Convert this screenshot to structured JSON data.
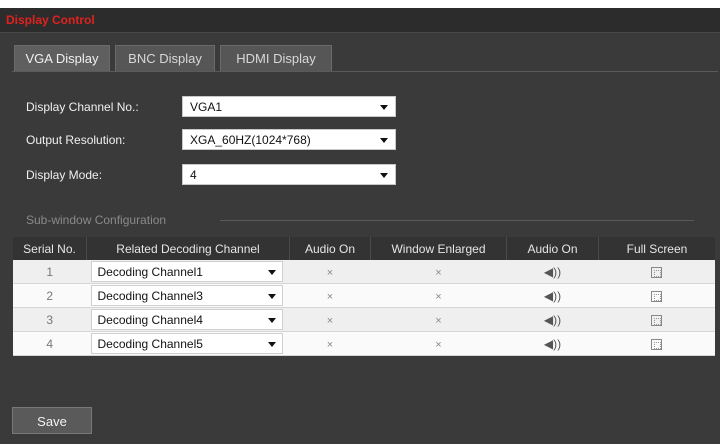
{
  "window": {
    "title": "Display Control"
  },
  "tabs": [
    {
      "label": "VGA Display",
      "active": true
    },
    {
      "label": "BNC Display",
      "active": false
    },
    {
      "label": "HDMI Display",
      "active": false
    }
  ],
  "form": {
    "display_channel": {
      "label": "Display Channel No.:",
      "value": "VGA1"
    },
    "output_resolution": {
      "label": "Output Resolution:",
      "value": "XGA_60HZ(1024*768)"
    },
    "display_mode": {
      "label": "Display Mode:",
      "value": "4"
    }
  },
  "subwindow": {
    "section_title": "Sub-window Configuration",
    "columns": [
      "Serial No.",
      "Related Decoding Channel",
      "Audio On",
      "Window Enlarged",
      "Audio On",
      "Full Screen"
    ],
    "rows": [
      {
        "serial": "1",
        "channel": "Decoding Channel1",
        "audio_on": "×",
        "window_enlarged": "×"
      },
      {
        "serial": "2",
        "channel": "Decoding Channel3",
        "audio_on": "×",
        "window_enlarged": "×"
      },
      {
        "serial": "3",
        "channel": "Decoding Channel4",
        "audio_on": "×",
        "window_enlarged": "×"
      },
      {
        "serial": "4",
        "channel": "Decoding Channel5",
        "audio_on": "×",
        "window_enlarged": "×"
      }
    ],
    "icons": {
      "audio": "speaker-icon",
      "fullscreen": "fullscreen-icon"
    }
  },
  "actions": {
    "save_label": "Save"
  },
  "colors": {
    "title": "#e0221e",
    "panel": "#3a3a3a"
  }
}
